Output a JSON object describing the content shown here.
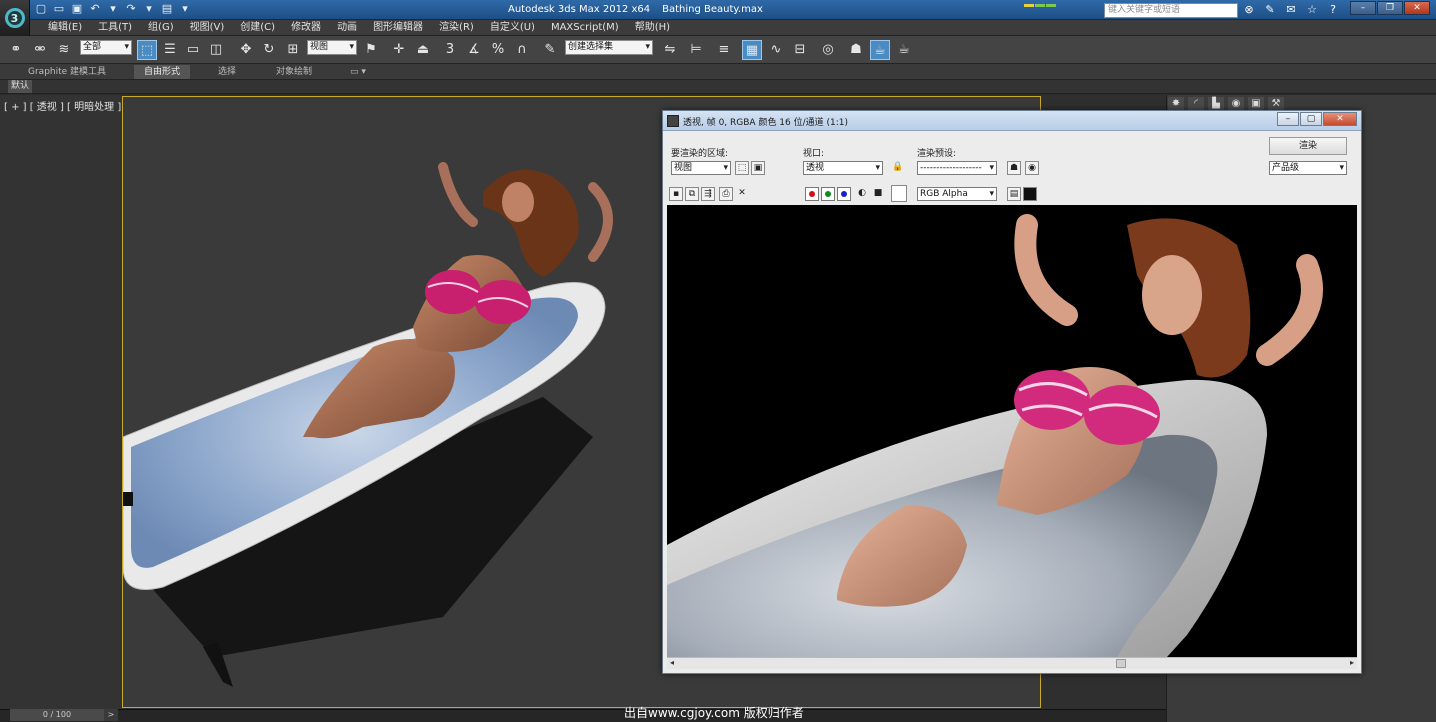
{
  "app": {
    "title": "Autodesk 3ds Max  2012 x64",
    "file": "Bathing Beauty.max",
    "search_placeholder": "键入关键字或短语"
  },
  "menu": [
    "编辑(E)",
    "工具(T)",
    "组(G)",
    "视图(V)",
    "创建(C)",
    "修改器",
    "动画",
    "图形编辑器",
    "渲染(R)",
    "自定义(U)",
    "MAXScript(M)",
    "帮助(H)"
  ],
  "toolbar": {
    "selection_filter": "全部",
    "reference_coord": "视图",
    "named_selection": "创建选择集",
    "snap_label": "3",
    "percent_snap": "%"
  },
  "ribbon": {
    "tabs": [
      "Graphite 建模工具",
      "自由形式",
      "选择",
      "对象绘制"
    ],
    "active_tab": "自由形式",
    "sub_label": "默认"
  },
  "viewport": {
    "label": "[ + ] [ 透视 ] [ 明暗处理 ]",
    "frame_counter": "0 / 100",
    "next": ">"
  },
  "render_window": {
    "title": "透视, 帧 0, RGBA 颜色 16 位/通道 (1:1)",
    "area_label": "要渲染的区域:",
    "area_value": "视图",
    "viewport_label": "视口:",
    "viewport_value": "透视",
    "preset_label": "渲染预设:",
    "preset_value": "-------------------",
    "render_button": "渲染",
    "quality_value": "产品级",
    "channel_value": "RGB Alpha"
  },
  "watermark": "出自www.cgjoy.com 版权归作者",
  "colors": {
    "title_bar": "#2f6aa8",
    "viewport_border": "#c9a92a",
    "active_tool": "#4a8bc2",
    "bikini": "#d0307a"
  }
}
